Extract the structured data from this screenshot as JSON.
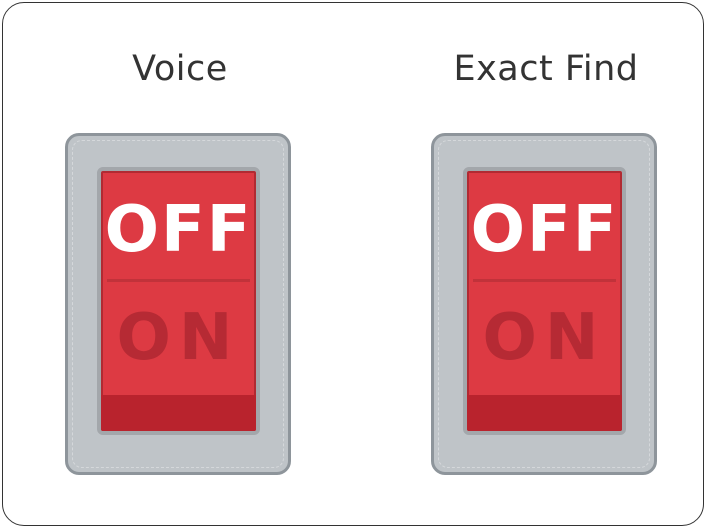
{
  "switches": [
    {
      "label": "Voice",
      "state_off": "OFF",
      "state_on": "ON",
      "current_state": "off"
    },
    {
      "label": "Exact Find",
      "state_off": "OFF",
      "state_on": "ON",
      "current_state": "off"
    }
  ],
  "colors": {
    "rocker_red": "#dd3a43",
    "rocker_dark_red": "#b9232d",
    "frame_gray": "#bfc4c8",
    "text_dark": "#333333"
  }
}
